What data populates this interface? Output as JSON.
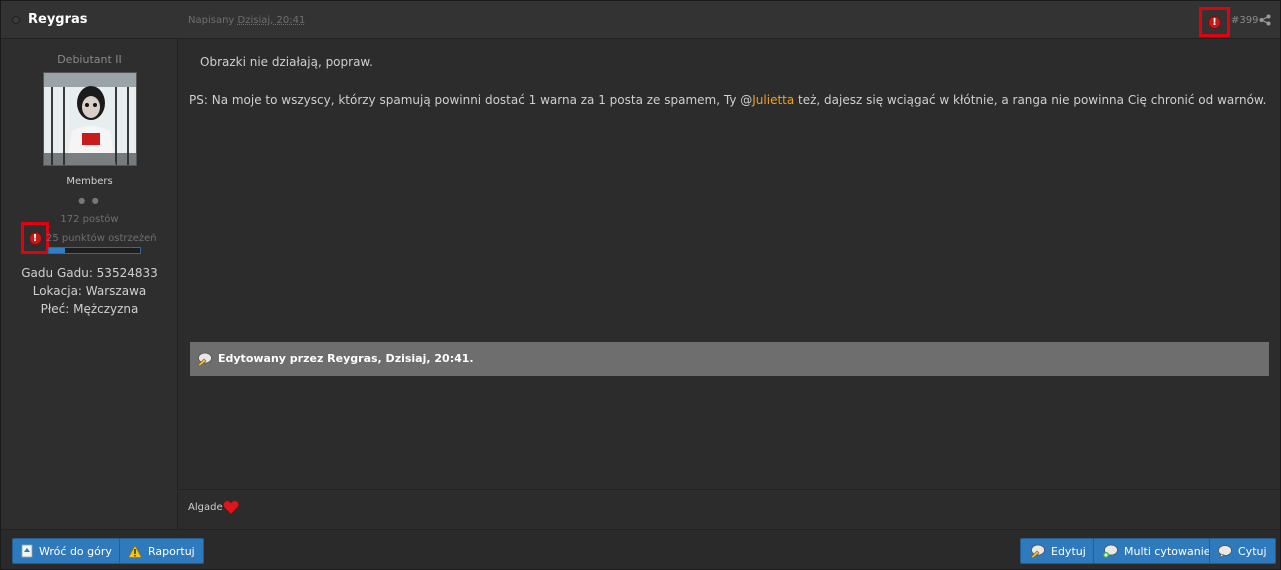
{
  "header": {
    "author": "Reygras",
    "posted_label": "Napisany",
    "posted_date": "Dzisiaj, 20:41",
    "post_number": "#399"
  },
  "sidebar": {
    "rank_title": "Debiutant II",
    "group": "Members",
    "pips": "● ●",
    "posts": "172 postów",
    "warn_points": "25 punktów ostrzeżeń",
    "warn_level_percent": 18,
    "fields": [
      "Gadu Gadu: 53524833",
      "Lokacja: Warszawa",
      "Płeć: Mężczyzna"
    ]
  },
  "content": {
    "line1": "Obrazki nie działają, popraw.",
    "line2_before": "PS: Na moje to wszyscy, którzy spamują powinni dostać 1 warna za 1 posta ze spamem, Ty @",
    "mention": "Julietta",
    "line2_after": " też, dajesz się wciągać w kłótnie, a ranga nie powinna Cię chronić od warnów.",
    "edited": "Edytowany przez Reygras, Dzisiaj, 20:41."
  },
  "signature": {
    "text": "Algade"
  },
  "footer": {
    "back_to_top": "Wróć do góry",
    "report": "Raportuj",
    "edit": "Edytuj",
    "multi_quote": "Multi cytowanie",
    "quote": "Cytuj"
  },
  "colors": {
    "accent_button": "#2f79bd",
    "mention": "#f2a11e",
    "highlight_box": "#e3000f"
  }
}
